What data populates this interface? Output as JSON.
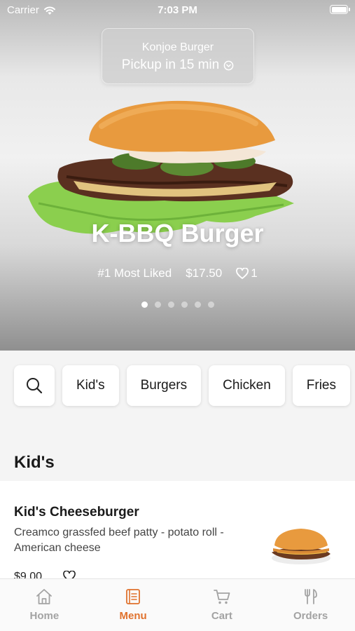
{
  "status_bar": {
    "carrier": "Carrier",
    "time": "7:03 PM"
  },
  "location": {
    "name": "Konjoe Burger",
    "pickup": "Pickup in 15 min"
  },
  "hero": {
    "title": "K-BBQ Burger",
    "badge": "#1 Most Liked",
    "price": "$17.50",
    "likes": "1",
    "carousel": {
      "count": 6,
      "active_index": 0
    }
  },
  "categories": [
    "Kid's",
    "Burgers",
    "Chicken",
    "Fries"
  ],
  "section": {
    "title": "Kid's"
  },
  "menu_item": {
    "name": "Kid's Cheeseburger",
    "description": "Creamco grassfed beef patty - potato roll - American cheese",
    "price": "$9.00"
  },
  "tabs": [
    {
      "label": "Home",
      "icon": "home-icon",
      "active": false
    },
    {
      "label": "Menu",
      "icon": "menu-icon",
      "active": true
    },
    {
      "label": "Cart",
      "icon": "cart-icon",
      "active": false
    },
    {
      "label": "Orders",
      "icon": "orders-icon",
      "active": false
    }
  ],
  "colors": {
    "accent": "#e0722d",
    "tab_inactive": "#a3a3a3",
    "background": "#f4f4f4"
  }
}
